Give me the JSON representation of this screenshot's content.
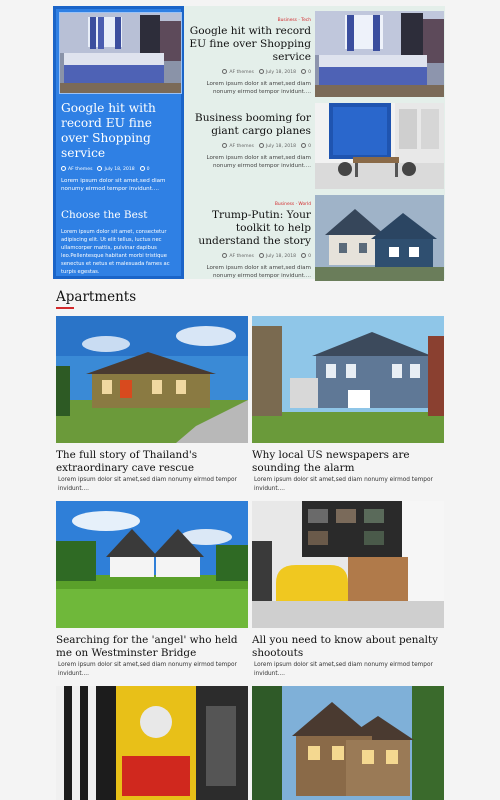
{
  "featured": {
    "main": {
      "title": "Google hit with record EU fine over Shopping service",
      "author": "AF themes",
      "date": "July 18, 2018",
      "comments": "0",
      "excerpt": "Lorem ipsum dolor sit amet,sed diam nonumy eirmod tempor invidunt....",
      "promo_title": "Choose the Best",
      "promo_text": "Lorem ipsum dolor sit amet, consectetur adipiscing elit. Ut elit tellus, luctus nec ullamcorper mattis, pulvinar dapibus leo.Pellentesque habitant morbi tristique senectus et netus et malesuada fames ac turpis egestas."
    },
    "list": [
      {
        "category": "Business · Tech",
        "title": "Google hit with record EU fine over Shopping service",
        "author": "AF themes",
        "date": "July 18, 2018",
        "comments": "0",
        "excerpt": "Lorem ipsum dolor sit amet,sed diam nonumy eirmod tempor invidunt...."
      },
      {
        "category": "",
        "title": "Business booming for giant cargo planes",
        "author": "AF themes",
        "date": "July 18, 2018",
        "comments": "0",
        "excerpt": "Lorem ipsum dolor sit amet,sed diam nonumy eirmod tempor invidunt...."
      },
      {
        "category": "Business · World",
        "title": "Trump-Putin: Your toolkit to help understand the story",
        "author": "AF themes",
        "date": "July 18, 2018",
        "comments": "0",
        "excerpt": "Lorem ipsum dolor sit amet,sed diam nonumy eirmod tempor invidunt...."
      }
    ]
  },
  "section": {
    "title": "Apartments",
    "accent": "#d2292c"
  },
  "grid": [
    {
      "title": "The full story of Thailand's extraordinary cave rescue",
      "excerpt": "Lorem ipsum dolor sit amet,sed diam nonumy eirmod tempor invidunt...."
    },
    {
      "title": "Why local US newspapers are sounding the alarm",
      "excerpt": "Lorem ipsum dolor sit amet,sed diam nonumy eirmod tempor invidunt...."
    },
    {
      "title": "Searching for the 'angel' who held me on Westminster Bridge",
      "excerpt": "Lorem ipsum dolor sit amet,sed diam nonumy eirmod tempor invidunt...."
    },
    {
      "title": "All you need to know about penalty shootouts",
      "excerpt": "Lorem ipsum dolor sit amet,sed diam nonumy eirmod tempor invidunt...."
    },
    {
      "title": "",
      "excerpt": ""
    },
    {
      "title": "",
      "excerpt": ""
    }
  ],
  "colors": {
    "feature_blue": "#2f80e4",
    "list_bg": "#e4efea",
    "accent_red": "#d2292c"
  },
  "icons": {
    "author": "user-icon",
    "date": "clock-icon",
    "comments": "comment-icon"
  }
}
